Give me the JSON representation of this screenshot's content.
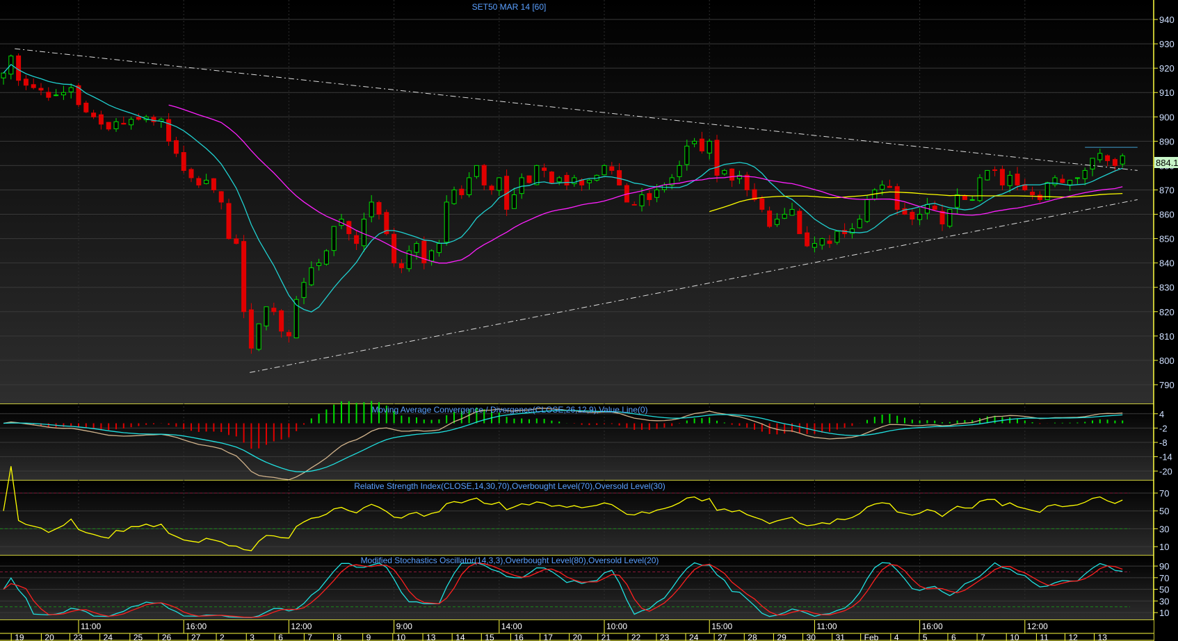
{
  "title": "SET50 MAR 14  [60]",
  "last_price": "884.10",
  "colors": {
    "up": "#00e000",
    "down": "#e00000",
    "axis": "#ffff40",
    "label": "#5aa0ff",
    "ma_fast": "#20d0d0",
    "ma_mid": "#ffff00",
    "ma_slow": "#ff20ff",
    "macd": "#d2b48c",
    "signal": "#20e0e0",
    "rsi": "#ffff00",
    "stoch_k": "#20e0e0",
    "stoch_d": "#ff2020"
  },
  "chart_data": [
    {
      "type": "candlestick",
      "name": "price",
      "ylim": [
        782,
        948
      ],
      "yticks": [
        940,
        930,
        920,
        910,
        900,
        890,
        880,
        870,
        860,
        850,
        840,
        830,
        820,
        810,
        800,
        790
      ],
      "closes": [
        918,
        925,
        915,
        913,
        912,
        911,
        908,
        909,
        910,
        912,
        905,
        902,
        900,
        897,
        895,
        898,
        897,
        899,
        899,
        900,
        898,
        899,
        890,
        885,
        878,
        875,
        872,
        874,
        870,
        865,
        850,
        848,
        820,
        805,
        815,
        822,
        820,
        812,
        810,
        825,
        832,
        838,
        840,
        845,
        855,
        858,
        852,
        848,
        858,
        865,
        860,
        852,
        840,
        838,
        845,
        848,
        840,
        845,
        848,
        865,
        870,
        868,
        875,
        880,
        872,
        870,
        875,
        862,
        868,
        875,
        873,
        880,
        878,
        873,
        875,
        872,
        875,
        872,
        874,
        876,
        880,
        878,
        872,
        865,
        864,
        868,
        866,
        870,
        872,
        875,
        880,
        888,
        890,
        886,
        890,
        876,
        878,
        874,
        876,
        870,
        866,
        862,
        855,
        858,
        860,
        862,
        852,
        847,
        848,
        850,
        848,
        853,
        852,
        854,
        858,
        866,
        870,
        872,
        871,
        862,
        860,
        858,
        860,
        864,
        862,
        856,
        862,
        868,
        866,
        866,
        875,
        878,
        878,
        872,
        876,
        872,
        870,
        868,
        866,
        873,
        875,
        873,
        874,
        875,
        878,
        883,
        885,
        882,
        880,
        884
      ],
      "moving_averages": [
        {
          "name": "MA fast",
          "period": 10
        },
        {
          "name": "MA mid",
          "period": 60
        },
        {
          "name": "MA slow",
          "period": 30
        }
      ],
      "trendlines": [
        {
          "name": "upper-trendline",
          "from": [
            1.5,
            928
          ],
          "to": [
            151,
            878
          ]
        },
        {
          "name": "lower-trendline",
          "from": [
            32.8,
            795
          ],
          "to": [
            151,
            866
          ]
        },
        {
          "name": "resistance-line",
          "from": [
            144,
            887.5
          ],
          "to": [
            151,
            887.5
          ]
        }
      ]
    },
    {
      "type": "line",
      "name": "macd",
      "title": "Moving Average Convergence / Divergence(CLOSE,26,12,9),Value Line(0)",
      "yticks": [
        4,
        -2,
        -8,
        -14,
        -20
      ],
      "ylim": [
        -24,
        8
      ],
      "params": [
        26,
        12,
        9
      ]
    },
    {
      "type": "line",
      "name": "rsi",
      "title": "Relative Strength Index(CLOSE,14,30,70),Overbought Level(70),Oversold Level(30)",
      "yticks": [
        70,
        50,
        30,
        10
      ],
      "ylim": [
        0,
        84
      ],
      "period": 14,
      "levels": [
        70,
        30
      ]
    },
    {
      "type": "line",
      "name": "stochastic",
      "title": "Modified Stochastics Oscillator(14,3,3),Overbought Level(80),Oversold Level(20)",
      "yticks": [
        90,
        70,
        50,
        30,
        10
      ],
      "ylim": [
        -3,
        108
      ],
      "params": [
        14,
        3,
        3
      ],
      "levels": [
        80,
        20
      ]
    }
  ],
  "time_axis": {
    "hours": [
      {
        "i": 10,
        "label": "11:00"
      },
      {
        "i": 24,
        "label": "16:00"
      },
      {
        "i": 38,
        "label": "12:00"
      },
      {
        "i": 52,
        "label": "9:00"
      },
      {
        "i": 66,
        "label": "14:00"
      },
      {
        "i": 80,
        "label": "10:00"
      },
      {
        "i": 94,
        "label": "15:00"
      },
      {
        "i": 108,
        "label": "11:00"
      },
      {
        "i": 122,
        "label": "16:00"
      },
      {
        "i": 136,
        "label": "12:00"
      }
    ],
    "dates": [
      {
        "i": 1.5,
        "label": "19"
      },
      {
        "i": 5.5,
        "label": "20"
      },
      {
        "i": 9.3,
        "label": "23"
      },
      {
        "i": 13.3,
        "label": "24"
      },
      {
        "i": 17.3,
        "label": "25"
      },
      {
        "i": 21.1,
        "label": "26"
      },
      {
        "i": 25,
        "label": "27"
      },
      {
        "i": 28.8,
        "label": "2"
      },
      {
        "i": 32.8,
        "label": "3"
      },
      {
        "i": 36.6,
        "label": "6"
      },
      {
        "i": 40.5,
        "label": "7"
      },
      {
        "i": 44.4,
        "label": "8"
      },
      {
        "i": 48.3,
        "label": "9"
      },
      {
        "i": 52.3,
        "label": "10"
      },
      {
        "i": 56.3,
        "label": "13"
      },
      {
        "i": 60.2,
        "label": "14"
      },
      {
        "i": 64.1,
        "label": "15"
      },
      {
        "i": 68,
        "label": "16"
      },
      {
        "i": 71.9,
        "label": "17"
      },
      {
        "i": 75.8,
        "label": "20"
      },
      {
        "i": 79.6,
        "label": "21"
      },
      {
        "i": 83.6,
        "label": "22"
      },
      {
        "i": 87.4,
        "label": "23"
      },
      {
        "i": 91.3,
        "label": "24"
      },
      {
        "i": 95.1,
        "label": "27"
      },
      {
        "i": 99.1,
        "label": "28"
      },
      {
        "i": 103,
        "label": "29"
      },
      {
        "i": 106.9,
        "label": "30"
      },
      {
        "i": 110.8,
        "label": "31"
      },
      {
        "i": 114.6,
        "label": "Feb"
      },
      {
        "i": 118.6,
        "label": "4"
      },
      {
        "i": 122.4,
        "label": "5"
      },
      {
        "i": 126.2,
        "label": "6"
      },
      {
        "i": 130.1,
        "label": "7"
      },
      {
        "i": 134,
        "label": "10"
      },
      {
        "i": 138,
        "label": "11"
      },
      {
        "i": 141.8,
        "label": "12"
      },
      {
        "i": 145.7,
        "label": "13"
      }
    ]
  }
}
